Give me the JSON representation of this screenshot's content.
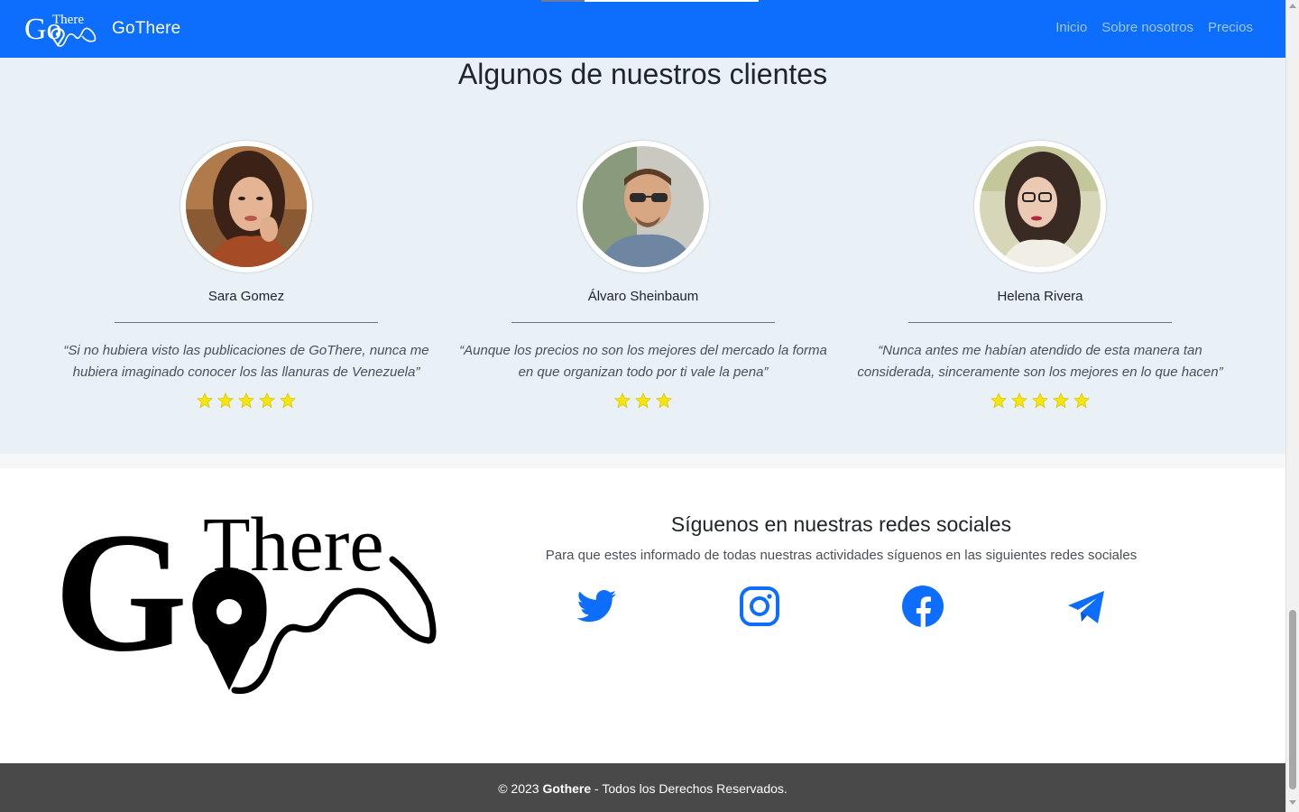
{
  "navbar": {
    "brand": "GoThere",
    "logo_text_go": "Go",
    "logo_text_there": "There",
    "links": [
      "Inicio",
      "Sobre nosotros",
      "Precios"
    ]
  },
  "testimonials": {
    "title": "Algunos de nuestros clientes",
    "clients": [
      {
        "name": "Sara Gomez",
        "quote": "“Si no hubiera visto las publicaciones de GoThere, nunca me hubiera imaginado conocer los las llanuras de Venezuela”",
        "stars": 5
      },
      {
        "name": "Álvaro Sheinbaum",
        "quote": "“Aunque los precios no son los mejores del mercado la forma en que organizan todo por ti vale la pena”",
        "stars": 3
      },
      {
        "name": "Helena Rivera",
        "quote": "“Nunca antes me habían atendido de esta manera tan considerada, sinceramente son los mejores en lo que hacen”",
        "stars": 5
      }
    ]
  },
  "social": {
    "title": "Síguenos en nuestras redes sociales",
    "subtitle": "Para que estes informado de todas nuestras actividades síguenos en las siguientes redes sociales",
    "icons": [
      "twitter-icon",
      "instagram-icon",
      "facebook-icon",
      "telegram-icon"
    ],
    "icon_color": "#0d6efd"
  },
  "footer": {
    "prefix": "© 2023 ",
    "brand": "Gothere",
    "suffix": " - Todos los Derechos Reservados."
  },
  "colors": {
    "navbar": "#0d6efd",
    "section_bg": "#e9f1f7",
    "footer_bg": "#4a4949",
    "star": "#f5e50a"
  }
}
